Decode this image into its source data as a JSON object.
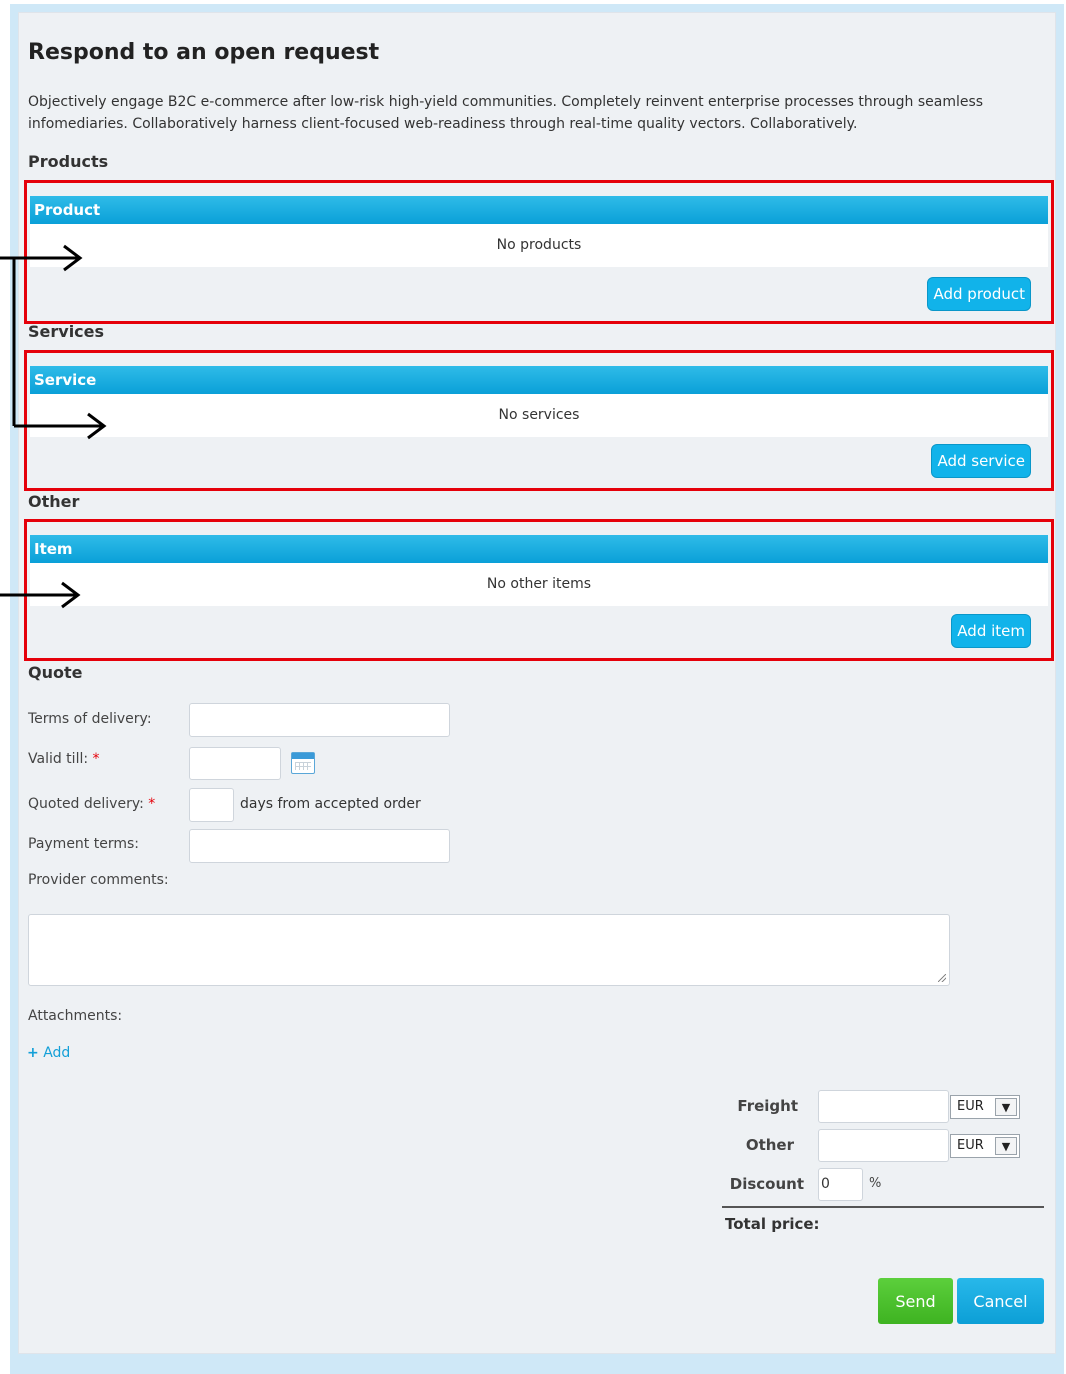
{
  "page": {
    "title": "Respond to an open request",
    "description": "Objectively engage B2C e-commerce after low-risk high-yield communities. Completely reinvent enterprise processes through seamless infomediaries. Collaboratively harness client-focused web-readiness through real-time quality vectors. Collaboratively."
  },
  "products": {
    "section_label": "Products",
    "column_header": "Product",
    "empty_text": "No products",
    "add_label": "Add product"
  },
  "services": {
    "section_label": "Services",
    "column_header": "Service",
    "empty_text": "No services",
    "add_label": "Add service"
  },
  "other": {
    "section_label": "Other",
    "column_header": "Item",
    "empty_text": "No other items",
    "add_label": "Add item"
  },
  "quote": {
    "section_label": "Quote",
    "terms_of_delivery_label": "Terms of delivery:",
    "valid_till_label": "Valid till:",
    "quoted_delivery_label": "Quoted delivery:",
    "quoted_delivery_suffix": "days from accepted order",
    "payment_terms_label": "Payment terms:",
    "provider_comments_label": "Provider comments:",
    "required_marker": "*",
    "attachments_label": "Attachments:",
    "add_attachment_plus": "+",
    "add_attachment_label": "Add"
  },
  "pricing": {
    "freight_label": "Freight",
    "freight_currency": "EUR",
    "other_label": "Other",
    "other_currency": "EUR",
    "discount_label": "Discount",
    "discount_value": "0",
    "discount_unit": "%",
    "total_label": "Total price:"
  },
  "actions": {
    "send_label": "Send",
    "cancel_label": "Cancel"
  },
  "icons": {
    "calendar": "calendar-icon",
    "dropdown": "chevron-down-icon",
    "annotation_arrow": "arrow-right-icon"
  },
  "colors": {
    "accent": "#11b3ea",
    "highlight": "#e5000a",
    "send": "#4cc12e"
  }
}
